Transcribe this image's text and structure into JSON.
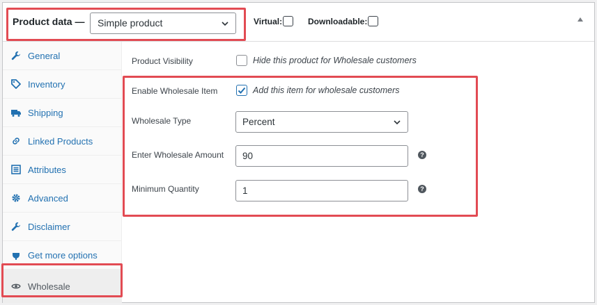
{
  "header": {
    "title": "Product data —",
    "product_type": "Simple product",
    "virtual_label": "Virtual:",
    "downloadable_label": "Downloadable:"
  },
  "sidebar": {
    "items": [
      {
        "label": "General",
        "icon": "wrench-icon"
      },
      {
        "label": "Inventory",
        "icon": "tag-icon"
      },
      {
        "label": "Shipping",
        "icon": "truck-icon"
      },
      {
        "label": "Linked Products",
        "icon": "link-icon"
      },
      {
        "label": "Attributes",
        "icon": "list-icon"
      },
      {
        "label": "Advanced",
        "icon": "gear-icon"
      },
      {
        "label": "Disclaimer",
        "icon": "wrench-icon"
      },
      {
        "label": "Get more options",
        "icon": "plugin-icon"
      },
      {
        "label": "Wholesale",
        "icon": "eye-icon"
      }
    ],
    "active": "Wholesale"
  },
  "main": {
    "visibility": {
      "label": "Product Visibility",
      "checked": false,
      "description": "Hide this product for Wholesale customers"
    },
    "enable": {
      "label": "Enable Wholesale Item",
      "checked": true,
      "description": "Add this item for wholesale customers"
    },
    "type": {
      "label": "Wholesale Type",
      "value": "Percent"
    },
    "amount": {
      "label": "Enter Wholesale Amount",
      "value": "90"
    },
    "min_qty": {
      "label": "Minimum Quantity",
      "value": "1"
    }
  },
  "colors": {
    "accent": "#2271b1",
    "highlight": "#e24b53"
  }
}
